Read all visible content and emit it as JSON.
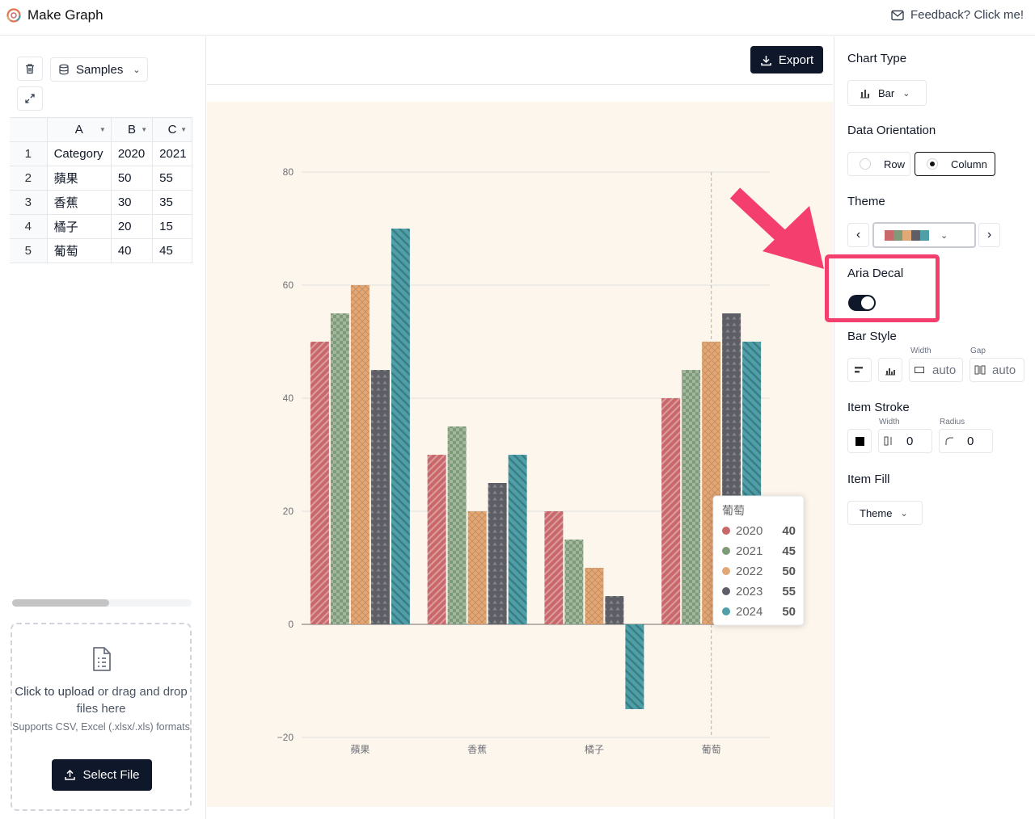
{
  "app": {
    "title": "Make Graph",
    "feedback": "Feedback? Click me!"
  },
  "left": {
    "samples_label": "Samples",
    "columns": [
      "A",
      "B",
      "C"
    ],
    "rows": [
      {
        "n": "1",
        "a": "Category",
        "b": "2020",
        "c": "2021"
      },
      {
        "n": "2",
        "a": "蘋果",
        "b": "50",
        "c": "55"
      },
      {
        "n": "3",
        "a": "香蕉",
        "b": "30",
        "c": "35"
      },
      {
        "n": "4",
        "a": "橘子",
        "b": "20",
        "c": "15"
      },
      {
        "n": "5",
        "a": "葡萄",
        "b": "40",
        "c": "45"
      }
    ],
    "upload": {
      "click_text": "Click to upload",
      "drag_text": " or drag and drop files here",
      "supports": "Supports CSV, Excel (.xlsx/.xls) formats",
      "button": "Select File"
    }
  },
  "toolbar": {
    "export_label": "Export"
  },
  "settings": {
    "chart_type_label": "Chart Type",
    "chart_type_value": "Bar",
    "orientation_label": "Data Orientation",
    "orientation_row": "Row",
    "orientation_column": "Column",
    "orientation_selected": "Column",
    "theme_label": "Theme",
    "aria_decal_label": "Aria Decal",
    "aria_decal_on": true,
    "bar_style_label": "Bar Style",
    "width_label": "Width",
    "width_value": "auto",
    "gap_label": "Gap",
    "gap_value": "auto",
    "item_stroke_label": "Item Stroke",
    "stroke_width_label": "Width",
    "stroke_width_value": "0",
    "radius_label": "Radius",
    "radius_value": "0",
    "item_fill_label": "Item Fill",
    "item_fill_value": "Theme"
  },
  "theme_colors": [
    "#c9686b",
    "#7f9a79",
    "#e1a877",
    "#5e5e66",
    "#4f9fa8"
  ],
  "chart_data": {
    "type": "bar",
    "categories": [
      "蘋果",
      "香蕉",
      "橘子",
      "葡萄"
    ],
    "series": [
      {
        "name": "2020",
        "color": "#c9686b",
        "values": [
          50,
          30,
          20,
          40
        ]
      },
      {
        "name": "2021",
        "color": "#7f9a79",
        "values": [
          55,
          35,
          15,
          45
        ]
      },
      {
        "name": "2022",
        "color": "#e1a877",
        "values": [
          60,
          20,
          10,
          50
        ]
      },
      {
        "name": "2023",
        "color": "#5e5e66",
        "values": [
          45,
          25,
          5,
          55
        ]
      },
      {
        "name": "2024",
        "color": "#4f9fa8",
        "values": [
          70,
          30,
          -15,
          50
        ]
      }
    ],
    "ylim": [
      -20,
      80
    ],
    "yticks": [
      "−20",
      "0",
      "20",
      "40",
      "60",
      "80"
    ],
    "ytick_values": [
      -20,
      0,
      20,
      40,
      60,
      80
    ],
    "grid": true,
    "decal": true,
    "tooltip": {
      "category": "葡萄",
      "rows": [
        {
          "name": "2020",
          "value": "40"
        },
        {
          "name": "2021",
          "value": "45"
        },
        {
          "name": "2022",
          "value": "50"
        },
        {
          "name": "2023",
          "value": "55"
        },
        {
          "name": "2024",
          "value": "50"
        }
      ]
    }
  }
}
